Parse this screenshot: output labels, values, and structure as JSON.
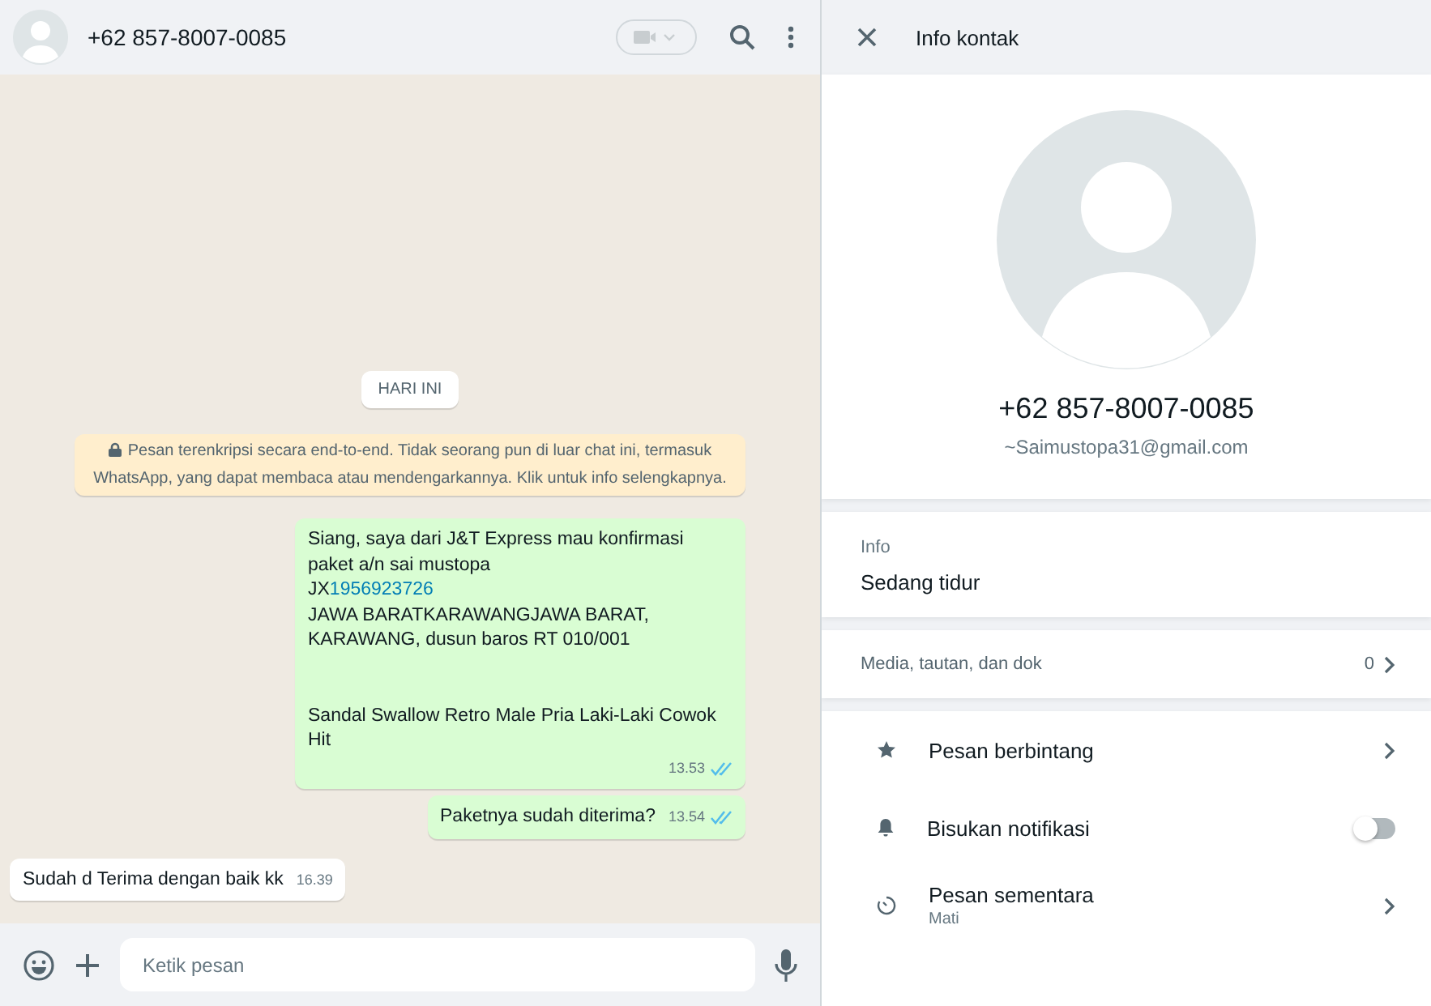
{
  "chat_header": {
    "title": "+62 857-8007-0085"
  },
  "chat": {
    "date_chip": "HARI INI",
    "encryption_notice": "Pesan terenkripsi secara end-to-end. Tidak seorang pun di luar chat ini, termasuk WhatsApp, yang dapat membaca atau mendengarkannya. Klik untuk info selengkapnya.",
    "messages": [
      {
        "kind": "out",
        "time": "13.53",
        "read": true,
        "blocks": [
          {
            "kind": "line",
            "text": "Siang, saya dari J&T Express mau konfirmasi paket a/n sai mustopa"
          },
          {
            "kind": "tracking",
            "prefix": "JX",
            "link": "1956923726"
          },
          {
            "kind": "line",
            "text": "JAWA BARATKARAWANGJAWA BARAT, KARAWANG, dusun baros RT 010/001"
          },
          {
            "kind": "paragraph",
            "text": "Sandal Swallow Retro Male Pria Laki-Laki Cowok Hit"
          }
        ]
      },
      {
        "kind": "out",
        "time": "13.54",
        "read": true,
        "blocks": [
          {
            "kind": "line",
            "text": "Paketnya sudah diterima?"
          }
        ]
      },
      {
        "kind": "in",
        "time": "16.39",
        "blocks": [
          {
            "kind": "line",
            "text": "Sudah d Terima dengan baik kk"
          }
        ]
      }
    ]
  },
  "composer": {
    "placeholder": "Ketik pesan"
  },
  "contact_info": {
    "title": "Info kontak",
    "name": "+62 857-8007-0085",
    "push_name": "~Saimustopa31@gmail.com",
    "about_label": "Info",
    "about": "Sedang tidur",
    "media_label": "Media, tautan, dan dok",
    "media_count": "0",
    "items": [
      {
        "kind": "link",
        "label": "Pesan berbintang"
      },
      {
        "kind": "toggle",
        "label": "Bisukan notifikasi",
        "on": false
      },
      {
        "kind": "link",
        "label": "Pesan sementara",
        "subtitle": "Mati"
      }
    ]
  }
}
